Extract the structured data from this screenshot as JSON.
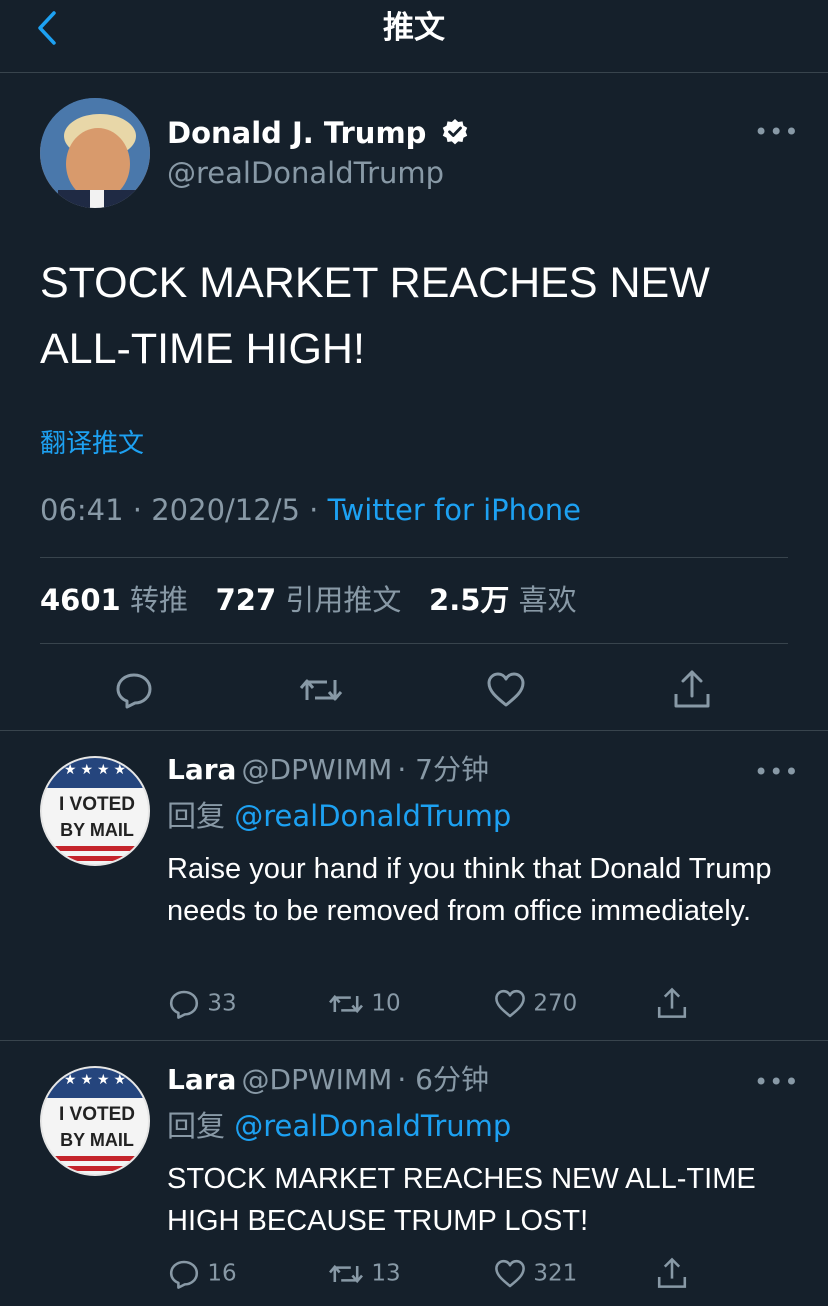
{
  "header": {
    "title": "推文"
  },
  "tweet": {
    "author_name": "Donald J. Trump",
    "author_handle": "@realDonaldTrump",
    "text": "STOCK MARKET REACHES NEW ALL-TIME HIGH!",
    "translate_label": "翻译推文",
    "time": "06:41",
    "date": "2020/12/5",
    "separator": "·",
    "source": "Twitter for iPhone",
    "retweets_count": "4601",
    "retweets_label": "转推",
    "quotes_count": "727",
    "quotes_label": "引用推文",
    "likes_count": "2.5万",
    "likes_label": "喜欢"
  },
  "replies": [
    {
      "name": "Lara",
      "handle": "@DPWIMM",
      "time": "· 7分钟",
      "reply_prefix": "回复",
      "reply_to": "@realDonaldTrump",
      "text": "Raise your hand if you think that Donald Trump needs to be removed from office immediately.",
      "reply_count": "33",
      "retweet_count": "10",
      "like_count": "270",
      "avatar_line1": "I VOTED",
      "avatar_line2": "BY MAIL"
    },
    {
      "name": "Lara",
      "handle": "@DPWIMM",
      "time": "· 6分钟",
      "reply_prefix": "回复",
      "reply_to": "@realDonaldTrump",
      "text": "STOCK MARKET REACHES NEW ALL-TIME HIGH BECAUSE TRUMP LOST!",
      "reply_count": "16",
      "retweet_count": "13",
      "like_count": "321",
      "avatar_line1": "I VOTED",
      "avatar_line2": "BY MAIL"
    }
  ],
  "icons": {
    "back": "chevron-left-icon",
    "verified": "verified-badge-icon",
    "more": "more-dots-icon",
    "reply": "reply-bubble-icon",
    "retweet": "retweet-icon",
    "like": "heart-icon",
    "share": "share-icon"
  },
  "colors": {
    "background": "#15202b",
    "accent": "#1da1f2",
    "muted": "#8899a6",
    "divider": "#38444d"
  }
}
